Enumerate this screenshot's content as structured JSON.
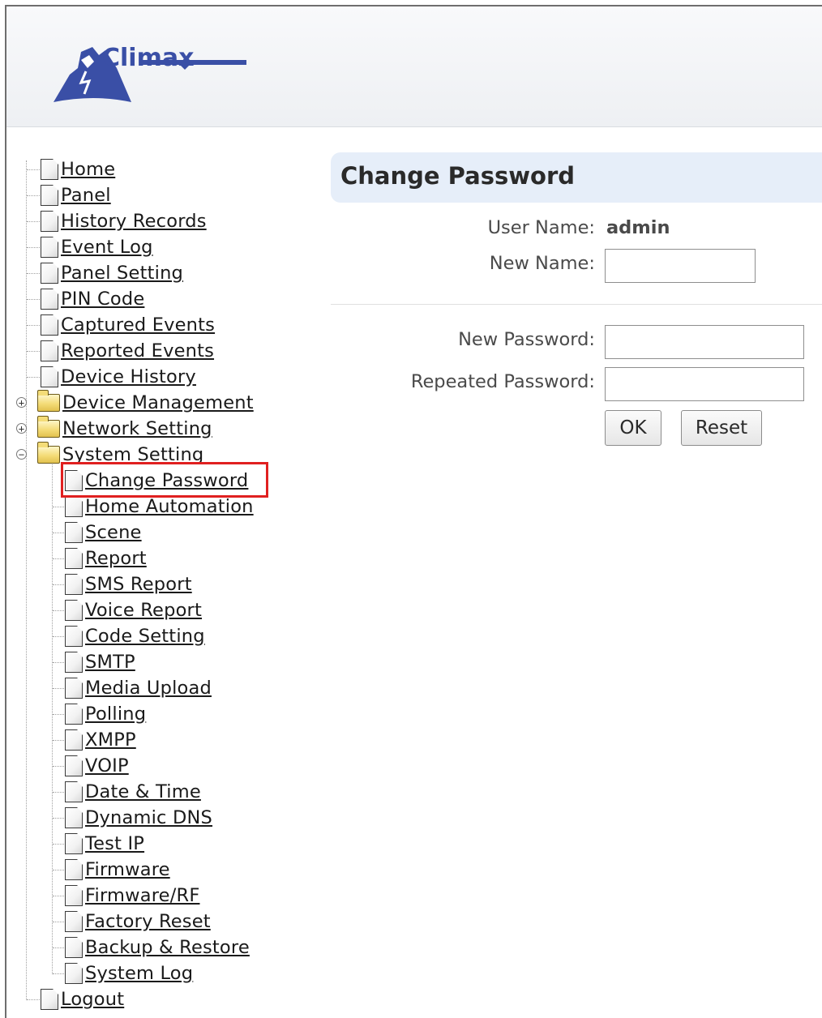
{
  "logo": {
    "text": "Climax"
  },
  "nav": {
    "top": [
      {
        "label": "Home"
      },
      {
        "label": "Panel"
      },
      {
        "label": "History Records"
      },
      {
        "label": "Event Log"
      },
      {
        "label": "Panel Setting"
      },
      {
        "label": "PIN Code"
      },
      {
        "label": "Captured Events"
      },
      {
        "label": "Reported Events"
      },
      {
        "label": "Device History"
      }
    ],
    "folders": [
      {
        "label": "Device Management",
        "expanded": false
      },
      {
        "label": "Network Setting",
        "expanded": false
      },
      {
        "label": "System Setting",
        "expanded": true
      }
    ],
    "system_items": [
      {
        "label": "Change Password",
        "selected": true
      },
      {
        "label": "Home Automation"
      },
      {
        "label": "Scene"
      },
      {
        "label": "Report"
      },
      {
        "label": "SMS Report"
      },
      {
        "label": "Voice Report"
      },
      {
        "label": "Code Setting"
      },
      {
        "label": "SMTP"
      },
      {
        "label": "Media Upload"
      },
      {
        "label": "Polling"
      },
      {
        "label": "XMPP"
      },
      {
        "label": "VOIP"
      },
      {
        "label": "Date & Time"
      },
      {
        "label": "Dynamic DNS"
      },
      {
        "label": "Test IP"
      },
      {
        "label": "Firmware"
      },
      {
        "label": "Firmware/RF"
      },
      {
        "label": "Factory Reset"
      },
      {
        "label": "Backup & Restore"
      },
      {
        "label": "System Log"
      }
    ],
    "logout": {
      "label": "Logout"
    }
  },
  "page": {
    "title": "Change Password",
    "user_name_label": "User Name:",
    "user_name_value": "admin",
    "new_name_label": "New Name:",
    "new_name_value": "",
    "new_password_label": "New Password:",
    "new_password_value": "",
    "repeated_password_label": "Repeated Password:",
    "repeated_password_value": "",
    "ok_label": "OK",
    "reset_label": "Reset"
  },
  "colors": {
    "title_bg": "#e6eef9",
    "logo_blue": "#3a4fa6",
    "highlight": "#e02020"
  }
}
